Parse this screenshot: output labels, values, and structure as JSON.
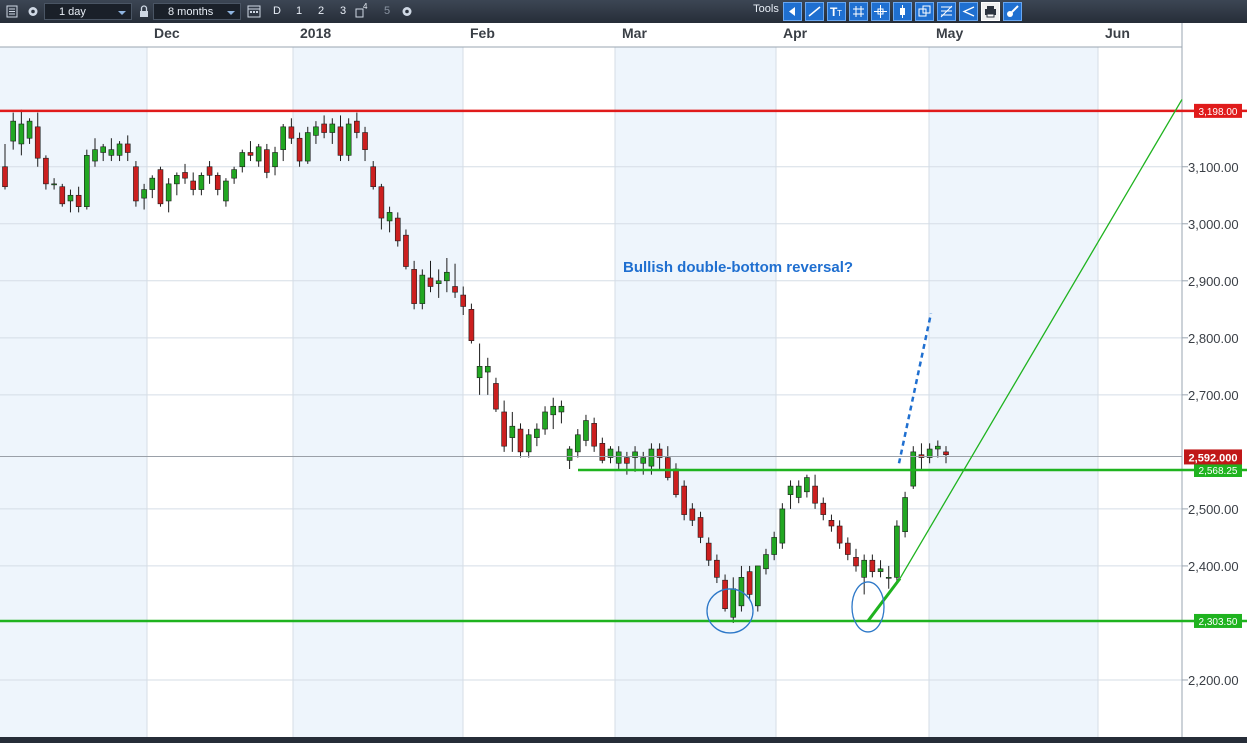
{
  "toolbar": {
    "interval": "1 day",
    "range": "8 months",
    "period_buttons": [
      "D",
      "1",
      "2",
      "3",
      "4",
      "5"
    ],
    "tools_label": "Tools"
  },
  "chart_data": {
    "type": "candlestick",
    "x_labels": [
      "Dec",
      "2018",
      "Feb",
      "Mar",
      "Apr",
      "May",
      "Jun"
    ],
    "y_ticks": [
      "3,100.00",
      "3,000.00",
      "2,900.00",
      "2,800.00",
      "2,700.00",
      "2,500.00",
      "2,400.00",
      "2,200.00"
    ],
    "ylim": [
      2100,
      3310
    ],
    "annotation": "Bullish double-bottom reversal?",
    "current_price_label": "2,592.000",
    "current_price": 2592,
    "levels": [
      {
        "value": 3198,
        "label": "3,198.00",
        "color": "#e01b1b"
      },
      {
        "value": 2568.25,
        "label": "2,568.25",
        "color": "#1fb31f"
      },
      {
        "value": 2303.5,
        "label": "2,303.50",
        "color": "#1fb31f"
      }
    ],
    "candles": [
      [
        3100,
        3140,
        3060,
        3065
      ],
      [
        3145,
        3195,
        3130,
        3180
      ],
      [
        3140,
        3200,
        3120,
        3175
      ],
      [
        3150,
        3185,
        3140,
        3180
      ],
      [
        3170,
        3195,
        3100,
        3115
      ],
      [
        3115,
        3120,
        3060,
        3070
      ],
      [
        3070,
        3080,
        3060,
        3070
      ],
      [
        3065,
        3070,
        3030,
        3035
      ],
      [
        3040,
        3060,
        3020,
        3050
      ],
      [
        3050,
        3065,
        3020,
        3030
      ],
      [
        3030,
        3130,
        3025,
        3120
      ],
      [
        3110,
        3150,
        3100,
        3130
      ],
      [
        3125,
        3140,
        3110,
        3135
      ],
      [
        3120,
        3150,
        3110,
        3130
      ],
      [
        3120,
        3145,
        3110,
        3140
      ],
      [
        3140,
        3155,
        3110,
        3125
      ],
      [
        3100,
        3110,
        3030,
        3040
      ],
      [
        3045,
        3070,
        3025,
        3060
      ],
      [
        3060,
        3085,
        3045,
        3080
      ],
      [
        3095,
        3100,
        3030,
        3035
      ],
      [
        3040,
        3080,
        3020,
        3070
      ],
      [
        3070,
        3090,
        3050,
        3085
      ],
      [
        3090,
        3105,
        3070,
        3080
      ],
      [
        3075,
        3090,
        3050,
        3060
      ],
      [
        3060,
        3090,
        3050,
        3085
      ],
      [
        3100,
        3110,
        3070,
        3085
      ],
      [
        3085,
        3090,
        3050,
        3060
      ],
      [
        3040,
        3080,
        3030,
        3075
      ],
      [
        3080,
        3100,
        3070,
        3095
      ],
      [
        3100,
        3130,
        3090,
        3125
      ],
      [
        3125,
        3145,
        3110,
        3120
      ],
      [
        3110,
        3140,
        3100,
        3135
      ],
      [
        3130,
        3140,
        3080,
        3090
      ],
      [
        3100,
        3135,
        3085,
        3125
      ],
      [
        3130,
        3175,
        3110,
        3170
      ],
      [
        3170,
        3185,
        3140,
        3150
      ],
      [
        3150,
        3160,
        3100,
        3110
      ],
      [
        3110,
        3170,
        3105,
        3160
      ],
      [
        3155,
        3180,
        3140,
        3170
      ],
      [
        3175,
        3190,
        3150,
        3160
      ],
      [
        3160,
        3185,
        3140,
        3175
      ],
      [
        3170,
        3190,
        3110,
        3120
      ],
      [
        3120,
        3185,
        3110,
        3175
      ],
      [
        3180,
        3195,
        3150,
        3160
      ],
      [
        3160,
        3170,
        3110,
        3130
      ],
      [
        3100,
        3110,
        3060,
        3065
      ],
      [
        3065,
        3070,
        2990,
        3010
      ],
      [
        3005,
        3030,
        2985,
        3020
      ],
      [
        3010,
        3020,
        2960,
        2970
      ],
      [
        2980,
        2990,
        2920,
        2925
      ],
      [
        2920,
        2935,
        2850,
        2860
      ],
      [
        2860,
        2920,
        2850,
        2910
      ],
      [
        2905,
        2935,
        2880,
        2890
      ],
      [
        2895,
        2920,
        2870,
        2900
      ],
      [
        2900,
        2940,
        2880,
        2915
      ],
      [
        2890,
        2930,
        2870,
        2880
      ],
      [
        2875,
        2890,
        2840,
        2855
      ],
      [
        2850,
        2860,
        2790,
        2795
      ],
      [
        2730,
        2790,
        2700,
        2750
      ],
      [
        2740,
        2765,
        2700,
        2750
      ],
      [
        2720,
        2730,
        2670,
        2675
      ],
      [
        2670,
        2690,
        2600,
        2610
      ],
      [
        2625,
        2670,
        2600,
        2645
      ],
      [
        2640,
        2650,
        2590,
        2600
      ],
      [
        2600,
        2640,
        2590,
        2630
      ],
      [
        2625,
        2650,
        2610,
        2640
      ],
      [
        2640,
        2680,
        2630,
        2670
      ],
      [
        2665,
        2695,
        2640,
        2680
      ],
      [
        2670,
        2690,
        2650,
        2680
      ],
      [
        2585,
        2610,
        2570,
        2605
      ],
      [
        2600,
        2640,
        2590,
        2630
      ],
      [
        2620,
        2665,
        2610,
        2655
      ],
      [
        2650,
        2660,
        2600,
        2610
      ],
      [
        2615,
        2625,
        2580,
        2585
      ],
      [
        2590,
        2610,
        2580,
        2605
      ],
      [
        2580,
        2610,
        2570,
        2600
      ],
      [
        2590,
        2600,
        2560,
        2580
      ],
      [
        2590,
        2610,
        2565,
        2600
      ],
      [
        2580,
        2600,
        2560,
        2590
      ],
      [
        2575,
        2615,
        2560,
        2605
      ],
      [
        2605,
        2615,
        2570,
        2590
      ],
      [
        2590,
        2610,
        2550,
        2555
      ],
      [
        2570,
        2580,
        2520,
        2525
      ],
      [
        2540,
        2550,
        2480,
        2490
      ],
      [
        2500,
        2510,
        2470,
        2480
      ],
      [
        2485,
        2495,
        2440,
        2450
      ],
      [
        2440,
        2450,
        2400,
        2410
      ],
      [
        2410,
        2420,
        2370,
        2380
      ],
      [
        2375,
        2385,
        2320,
        2325
      ],
      [
        2310,
        2380,
        2300,
        2360
      ],
      [
        2330,
        2400,
        2320,
        2380
      ],
      [
        2390,
        2400,
        2340,
        2350
      ],
      [
        2330,
        2400,
        2320,
        2400
      ],
      [
        2395,
        2430,
        2385,
        2420
      ],
      [
        2420,
        2460,
        2410,
        2450
      ],
      [
        2440,
        2510,
        2430,
        2500
      ],
      [
        2525,
        2550,
        2500,
        2540
      ],
      [
        2520,
        2550,
        2510,
        2540
      ],
      [
        2530,
        2560,
        2520,
        2555
      ],
      [
        2540,
        2560,
        2500,
        2510
      ],
      [
        2510,
        2520,
        2480,
        2490
      ],
      [
        2480,
        2490,
        2460,
        2470
      ],
      [
        2470,
        2480,
        2430,
        2440
      ],
      [
        2440,
        2450,
        2410,
        2420
      ],
      [
        2415,
        2430,
        2390,
        2400
      ],
      [
        2380,
        2420,
        2350,
        2410
      ],
      [
        2410,
        2420,
        2380,
        2390
      ],
      [
        2390,
        2410,
        2380,
        2395
      ],
      [
        2380,
        2400,
        2360,
        2380
      ],
      [
        2380,
        2480,
        2370,
        2470
      ],
      [
        2460,
        2530,
        2450,
        2520
      ],
      [
        2540,
        2610,
        2535,
        2600
      ],
      [
        2595,
        2615,
        2570,
        2590
      ],
      [
        2590,
        2615,
        2580,
        2605
      ],
      [
        2605,
        2620,
        2590,
        2610
      ],
      [
        2600,
        2610,
        2580,
        2595
      ]
    ]
  }
}
